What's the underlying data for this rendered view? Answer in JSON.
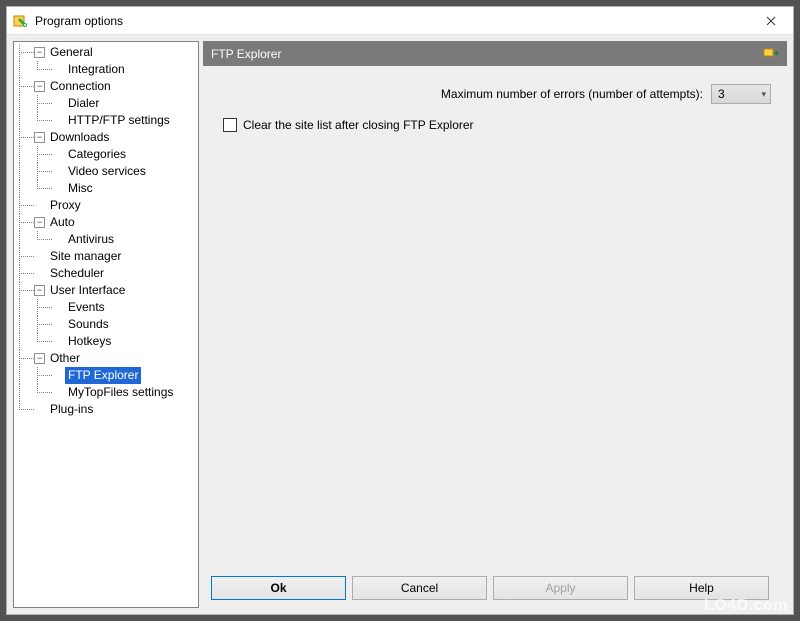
{
  "window": {
    "title": "Program options"
  },
  "tree": {
    "items": [
      {
        "label": "General",
        "expanded": true,
        "children": [
          {
            "label": "Integration"
          }
        ]
      },
      {
        "label": "Connection",
        "expanded": true,
        "children": [
          {
            "label": "Dialer"
          },
          {
            "label": "HTTP/FTP settings"
          }
        ]
      },
      {
        "label": "Downloads",
        "expanded": true,
        "children": [
          {
            "label": "Categories"
          },
          {
            "label": "Video services"
          },
          {
            "label": "Misc"
          }
        ]
      },
      {
        "label": "Proxy"
      },
      {
        "label": "Auto",
        "expanded": true,
        "children": [
          {
            "label": "Antivirus"
          }
        ]
      },
      {
        "label": "Site manager"
      },
      {
        "label": "Scheduler"
      },
      {
        "label": "User Interface",
        "expanded": true,
        "children": [
          {
            "label": "Events"
          },
          {
            "label": "Sounds"
          },
          {
            "label": "Hotkeys"
          }
        ]
      },
      {
        "label": "Other",
        "expanded": true,
        "children": [
          {
            "label": "FTP Explorer",
            "selected": true
          },
          {
            "label": "MyTopFiles settings"
          }
        ]
      },
      {
        "label": "Plug-ins"
      }
    ]
  },
  "panel": {
    "title": "FTP Explorer",
    "errors_label": "Maximum number of errors (number of attempts):",
    "errors_value": "3",
    "checkbox_label": "Clear the site list after closing FTP Explorer",
    "checkbox_checked": false
  },
  "buttons": {
    "ok": "Ok",
    "cancel": "Cancel",
    "apply": "Apply",
    "help": "Help"
  },
  "watermark": "LO4D.com"
}
